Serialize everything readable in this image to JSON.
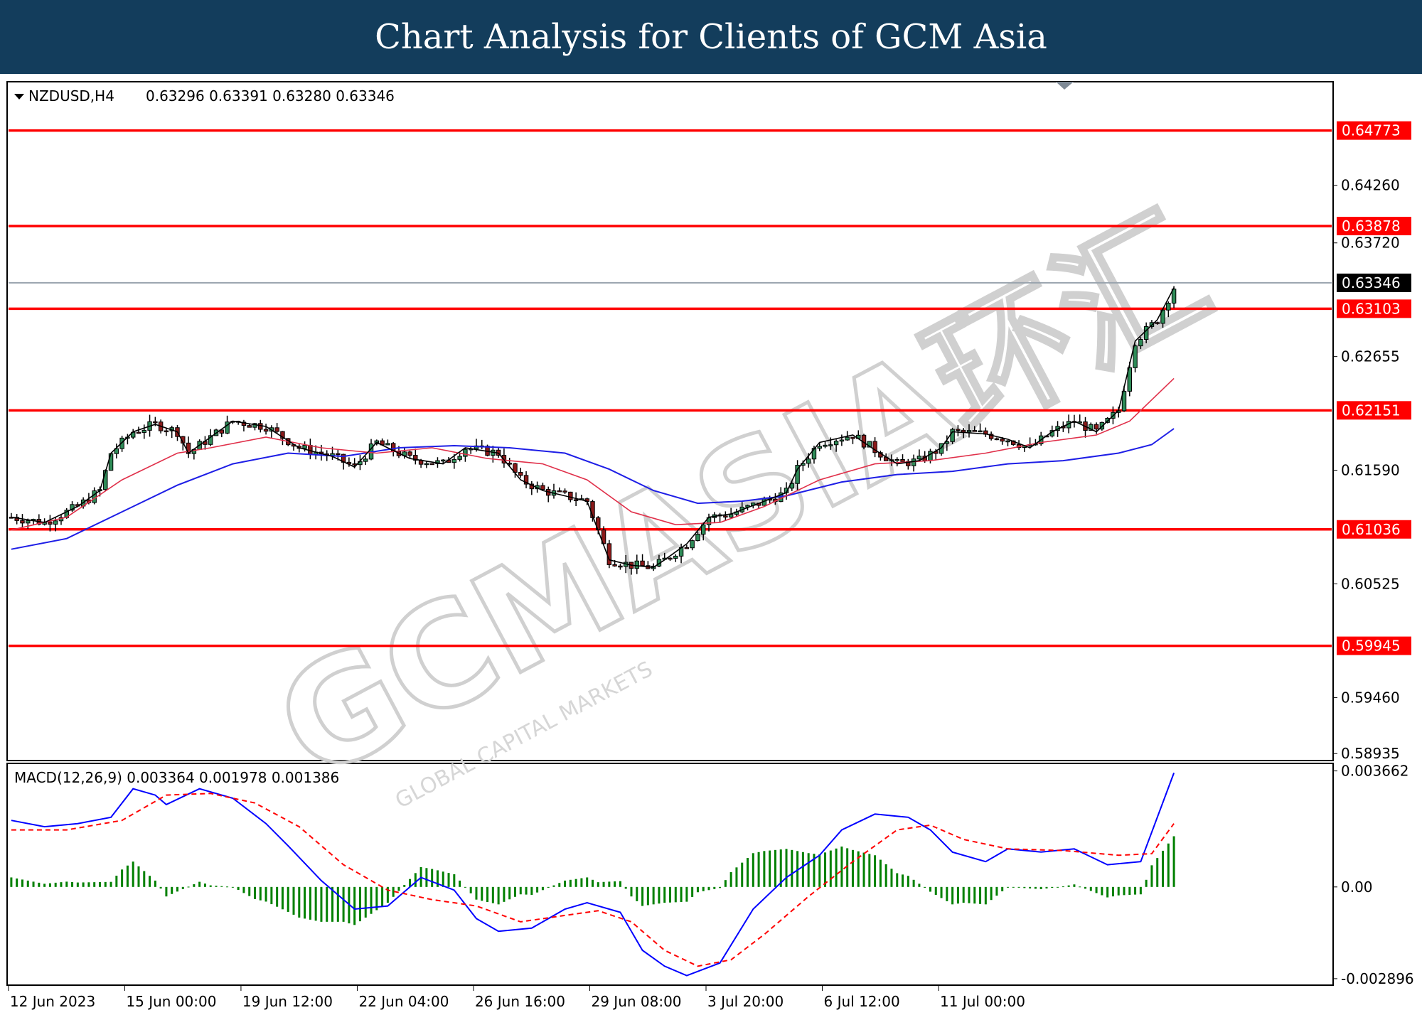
{
  "header": {
    "title": "Chart Analysis for Clients of GCM Asia"
  },
  "chart_data": [
    {
      "type": "candlestick",
      "symbol": "NZDUSD,H4",
      "ohlc_header": "0.63296 0.63391 0.63280 0.63346",
      "y_ticks": [
        "0.64260",
        "0.63720",
        "0.62655",
        "0.61590",
        "0.60525",
        "0.59460",
        "0.58935"
      ],
      "y_range": [
        0.5887,
        0.6523
      ],
      "current_price": {
        "label": "0.63346",
        "value": 0.63346,
        "color": "#000000"
      },
      "levels": [
        {
          "label": "0.64773",
          "value": 0.64773
        },
        {
          "label": "0.63878",
          "value": 0.63878
        },
        {
          "label": "0.63103",
          "value": 0.63103
        },
        {
          "label": "0.62151",
          "value": 0.62151
        },
        {
          "label": "0.61036",
          "value": 0.61036
        },
        {
          "label": "0.59945",
          "value": 0.59945
        }
      ],
      "level_color": "#ff0000",
      "x_labels": [
        "12 Jun 2023",
        "15 Jun 00:00",
        "19 Jun 12:00",
        "22 Jun 04:00",
        "26 Jun 16:00",
        "29 Jun 08:00",
        "3 Jul 20:00",
        "6 Jul 12:00",
        "11 Jul 00:00"
      ],
      "close_path": [
        [
          0,
          0.6115
        ],
        [
          6,
          0.611
        ],
        [
          12,
          0.6125
        ],
        [
          16,
          0.614
        ],
        [
          18,
          0.6175
        ],
        [
          22,
          0.6195
        ],
        [
          26,
          0.6202
        ],
        [
          30,
          0.6195
        ],
        [
          32,
          0.6175
        ],
        [
          36,
          0.619
        ],
        [
          40,
          0.6205
        ],
        [
          46,
          0.62
        ],
        [
          52,
          0.618
        ],
        [
          58,
          0.6172
        ],
        [
          62,
          0.6162
        ],
        [
          66,
          0.6185
        ],
        [
          72,
          0.617
        ],
        [
          78,
          0.6165
        ],
        [
          82,
          0.618
        ],
        [
          88,
          0.6175
        ],
        [
          92,
          0.615
        ],
        [
          96,
          0.614
        ],
        [
          100,
          0.6135
        ],
        [
          104,
          0.613
        ],
        [
          108,
          0.6075
        ],
        [
          112,
          0.607
        ],
        [
          116,
          0.6068
        ],
        [
          118,
          0.6075
        ],
        [
          122,
          0.609
        ],
        [
          126,
          0.6115
        ],
        [
          130,
          0.6118
        ],
        [
          136,
          0.613
        ],
        [
          140,
          0.6138
        ],
        [
          142,
          0.616
        ],
        [
          146,
          0.6185
        ],
        [
          152,
          0.6192
        ],
        [
          156,
          0.6178
        ],
        [
          160,
          0.6165
        ],
        [
          164,
          0.6168
        ],
        [
          168,
          0.618
        ],
        [
          170,
          0.6195
        ],
        [
          176,
          0.6193
        ],
        [
          180,
          0.6188
        ],
        [
          184,
          0.618
        ],
        [
          188,
          0.6195
        ],
        [
          190,
          0.62
        ],
        [
          192,
          0.6205
        ],
        [
          196,
          0.6195
        ],
        [
          200,
          0.6215
        ],
        [
          203,
          0.628
        ],
        [
          207,
          0.63
        ],
        [
          210,
          0.633
        ]
      ],
      "ema_red_path": [
        [
          0,
          0.6103
        ],
        [
          10,
          0.6115
        ],
        [
          20,
          0.615
        ],
        [
          30,
          0.6175
        ],
        [
          36,
          0.618
        ],
        [
          46,
          0.619
        ],
        [
          56,
          0.618
        ],
        [
          66,
          0.6175
        ],
        [
          76,
          0.618
        ],
        [
          86,
          0.617
        ],
        [
          96,
          0.6165
        ],
        [
          104,
          0.615
        ],
        [
          112,
          0.612
        ],
        [
          120,
          0.6108
        ],
        [
          128,
          0.611
        ],
        [
          136,
          0.6125
        ],
        [
          146,
          0.615
        ],
        [
          156,
          0.6165
        ],
        [
          166,
          0.6168
        ],
        [
          176,
          0.6175
        ],
        [
          186,
          0.6185
        ],
        [
          196,
          0.6192
        ],
        [
          202,
          0.6205
        ],
        [
          210,
          0.6245
        ]
      ],
      "ema_blue_path": [
        [
          0,
          0.6085
        ],
        [
          10,
          0.6095
        ],
        [
          20,
          0.612
        ],
        [
          30,
          0.6145
        ],
        [
          40,
          0.6165
        ],
        [
          50,
          0.6175
        ],
        [
          60,
          0.6172
        ],
        [
          70,
          0.618
        ],
        [
          80,
          0.6182
        ],
        [
          90,
          0.618
        ],
        [
          100,
          0.6175
        ],
        [
          108,
          0.616
        ],
        [
          116,
          0.614
        ],
        [
          124,
          0.6128
        ],
        [
          132,
          0.613
        ],
        [
          140,
          0.6135
        ],
        [
          150,
          0.6148
        ],
        [
          160,
          0.6155
        ],
        [
          170,
          0.6158
        ],
        [
          180,
          0.6165
        ],
        [
          190,
          0.6168
        ],
        [
          200,
          0.6175
        ],
        [
          206,
          0.6183
        ],
        [
          210,
          0.6198
        ]
      ],
      "n_bars": 211
    },
    {
      "type": "macd",
      "label": "MACD(12,26,9) 0.003364 0.001978 0.001386",
      "y_ticks": [
        "0.003662",
        "0.00",
        "-0.002896"
      ],
      "y_range": [
        -0.0031,
        0.0039
      ],
      "macd_path": [
        [
          0,
          0.0021
        ],
        [
          6,
          0.0019
        ],
        [
          12,
          0.002
        ],
        [
          18,
          0.0022
        ],
        [
          22,
          0.0031
        ],
        [
          26,
          0.0029
        ],
        [
          28,
          0.0026
        ],
        [
          34,
          0.0031
        ],
        [
          40,
          0.0028
        ],
        [
          46,
          0.002
        ],
        [
          50,
          0.0013
        ],
        [
          56,
          0.0002
        ],
        [
          62,
          -0.0007
        ],
        [
          68,
          -0.0006
        ],
        [
          74,
          0.0003
        ],
        [
          80,
          -0.0001
        ],
        [
          84,
          -0.001
        ],
        [
          88,
          -0.0014
        ],
        [
          94,
          -0.0013
        ],
        [
          100,
          -0.0007
        ],
        [
          104,
          -0.0005
        ],
        [
          110,
          -0.0008
        ],
        [
          114,
          -0.002
        ],
        [
          118,
          -0.0025
        ],
        [
          122,
          -0.0028
        ],
        [
          128,
          -0.0024
        ],
        [
          134,
          -0.0007
        ],
        [
          140,
          0.0003
        ],
        [
          146,
          0.001
        ],
        [
          150,
          0.0018
        ],
        [
          156,
          0.0023
        ],
        [
          162,
          0.0022
        ],
        [
          166,
          0.0018
        ],
        [
          170,
          0.0011
        ],
        [
          176,
          0.0008
        ],
        [
          180,
          0.0012
        ],
        [
          186,
          0.0011
        ],
        [
          192,
          0.0012
        ],
        [
          198,
          0.0007
        ],
        [
          204,
          0.0008
        ],
        [
          210,
          0.0036
        ]
      ],
      "signal_path": [
        [
          0,
          0.0018
        ],
        [
          10,
          0.0018
        ],
        [
          20,
          0.0021
        ],
        [
          28,
          0.0029
        ],
        [
          36,
          0.00295
        ],
        [
          44,
          0.00265
        ],
        [
          52,
          0.0019
        ],
        [
          60,
          0.0007
        ],
        [
          68,
          -0.0001
        ],
        [
          76,
          -0.0004
        ],
        [
          84,
          -0.0006
        ],
        [
          92,
          -0.0011
        ],
        [
          100,
          -0.0009
        ],
        [
          106,
          -0.00075
        ],
        [
          112,
          -0.0011
        ],
        [
          118,
          -0.002
        ],
        [
          124,
          -0.0025
        ],
        [
          130,
          -0.0023
        ],
        [
          136,
          -0.0015
        ],
        [
          144,
          -0.0003
        ],
        [
          152,
          0.0008
        ],
        [
          160,
          0.0018
        ],
        [
          166,
          0.00195
        ],
        [
          172,
          0.0015
        ],
        [
          180,
          0.0012
        ],
        [
          190,
          0.00115
        ],
        [
          200,
          0.001
        ],
        [
          206,
          0.00105
        ],
        [
          210,
          0.002
        ]
      ],
      "histogram_color": "#008000",
      "macd_color": "#0000ff",
      "signal_color": "#ff0000"
    }
  ],
  "watermark": {
    "main": "GCMASIA环汇",
    "sub": "GLOBAL CAPITAL MARKETS"
  }
}
